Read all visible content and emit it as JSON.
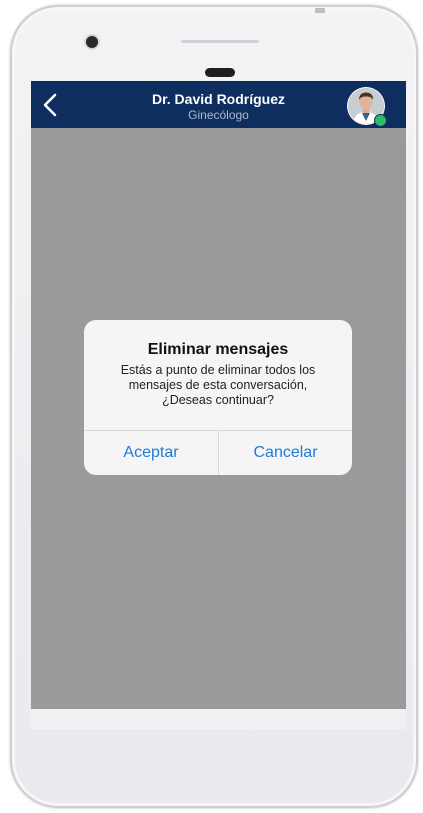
{
  "header": {
    "doctor_name": "Dr. David Rodríguez",
    "specialty": "Ginecólogo",
    "back_icon": "chevron-left-icon",
    "avatar": "doctor-avatar",
    "status": "online",
    "status_color": "#2ebd63"
  },
  "dialog": {
    "title": "Eliminar mensajes",
    "message_line1": "Estás a punto de eliminar todos los",
    "message_line2": "mensajes de esta conversación,",
    "message_line3": "¿Deseas continuar?",
    "accept_label": "Aceptar",
    "cancel_label": "Cancelar"
  },
  "colors": {
    "navbar": "#0d2e5e",
    "overlay": "#9a9a9a",
    "dialog_bg": "#f5f5f5",
    "action": "#1f7bd8"
  }
}
